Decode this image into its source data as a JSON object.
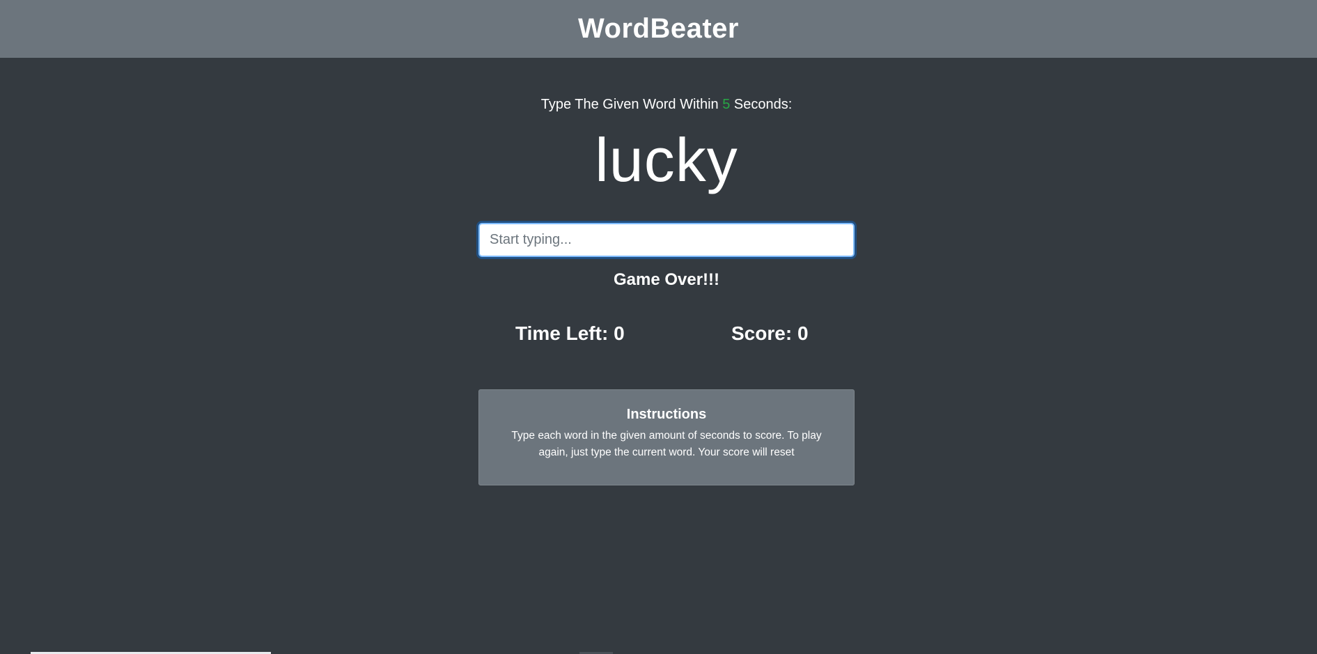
{
  "navbar": {
    "brand": "WordBeater"
  },
  "prompt": {
    "prefix": "Type The Given Word Within ",
    "seconds": "5",
    "suffix": " Seconds:"
  },
  "game": {
    "current_word": "lucky",
    "input_value": "",
    "input_placeholder": "Start typing...",
    "message": "Game Over!!!",
    "time_left_label": "Time Left: ",
    "time_left": "0",
    "score_label": "Score: ",
    "score": "0"
  },
  "instructions": {
    "title": "Instructions",
    "body": "Type each word in the given amount of seconds to score. To play again, just type the current word. Your score will reset"
  },
  "colors": {
    "background": "#343a40",
    "navbar": "#6c757d",
    "seconds_accent": "#28a745",
    "card": "#6c757d",
    "input_focus": "#80bdff"
  }
}
